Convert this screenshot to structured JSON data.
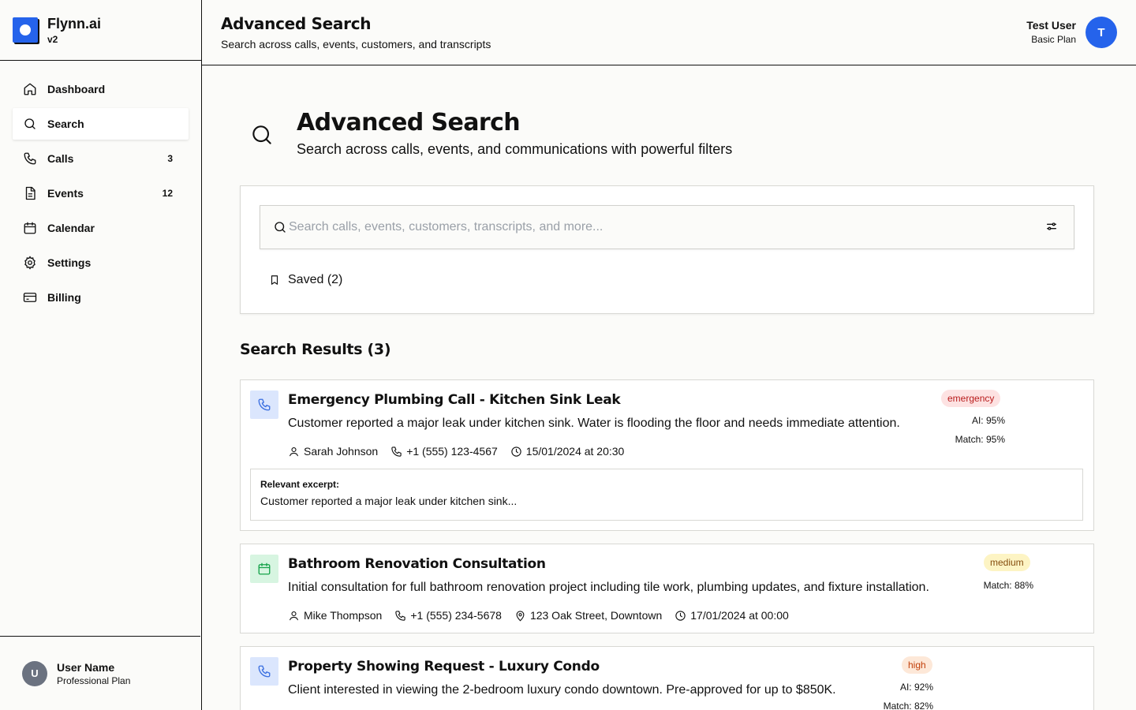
{
  "brand": {
    "name": "Flynn.ai",
    "version": "v2"
  },
  "sidebar": {
    "items": [
      {
        "label": "Dashboard",
        "count": ""
      },
      {
        "label": "Search",
        "count": ""
      },
      {
        "label": "Calls",
        "count": "3"
      },
      {
        "label": "Events",
        "count": "12"
      },
      {
        "label": "Calendar",
        "count": ""
      },
      {
        "label": "Settings",
        "count": ""
      },
      {
        "label": "Billing",
        "count": ""
      }
    ],
    "active": "Search",
    "user": {
      "initial": "U",
      "name": "User Name",
      "plan": "Professional Plan"
    }
  },
  "header": {
    "title": "Advanced Search",
    "subtitle": "Search across calls, events, customers, and transcripts",
    "user": {
      "name": "Test User",
      "plan": "Basic Plan",
      "initial": "T"
    }
  },
  "main": {
    "title": "Advanced Search",
    "subtitle": "Search across calls, events, and communications with powerful filters",
    "search": {
      "placeholder": "Search calls, events, customers, transcripts, and more...",
      "value": ""
    },
    "saved_label": "Saved (2)",
    "results_title": "Search Results (3)",
    "results": [
      {
        "type": "call",
        "icon": "phone-icon",
        "title": "Emergency Plumbing Call - Kitchen Sink Leak",
        "description": "Customer reported a major leak under kitchen sink. Water is flooding the floor and needs immediate attention.",
        "customer": "Sarah Johnson",
        "phone": "+1 (555) 123-4567",
        "datetime": "15/01/2024 at 20:30",
        "badge": "emergency",
        "ai_score": "AI: 95%",
        "match": "Match: 95%",
        "excerpt_label": "Relevant excerpt:",
        "excerpt": "Customer reported a major leak under kitchen sink..."
      },
      {
        "type": "event",
        "icon": "calendar-icon",
        "title": "Bathroom Renovation Consultation",
        "description": "Initial consultation for full bathroom renovation project including tile work, plumbing updates, and fixture installation.",
        "customer": "Mike Thompson",
        "phone": "+1 (555) 234-5678",
        "location": "123 Oak Street, Downtown",
        "datetime": "17/01/2024 at 00:00",
        "badge": "medium",
        "match": "Match: 88%"
      },
      {
        "type": "call",
        "icon": "phone-icon",
        "title": "Property Showing Request - Luxury Condo",
        "description": "Client interested in viewing the 2-bedroom luxury condo downtown. Pre-approved for up to $850K.",
        "badge": "high",
        "ai_score": "AI: 92%",
        "match": "Match: 82%"
      }
    ]
  },
  "colors": {
    "accent": "#2563eb",
    "emergency_bg": "#fde2e2",
    "emergency_fg": "#b91c1c",
    "medium_bg": "#fdf4c4",
    "high_bg": "#fde8d8"
  }
}
